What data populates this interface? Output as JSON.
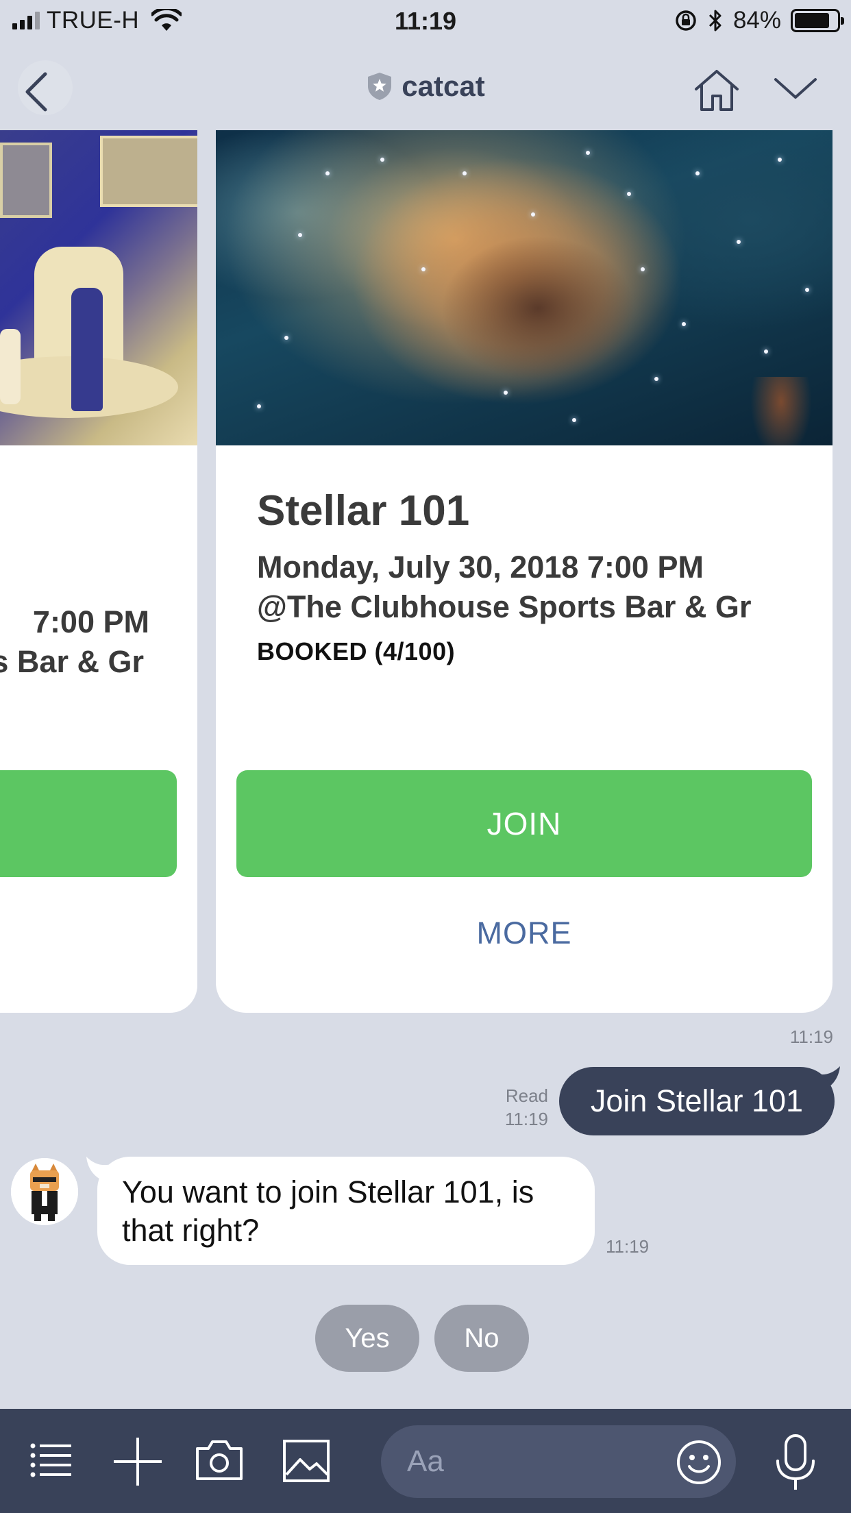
{
  "status_bar": {
    "carrier": "TRUE-H",
    "time": "11:19",
    "battery_percent": "84%",
    "battery_level": 0.84,
    "signal_bars": 3
  },
  "header": {
    "title": "catcat",
    "icons": [
      "back-arrow-icon",
      "shield-star-icon",
      "home-icon",
      "chevron-down-icon"
    ]
  },
  "carousel": {
    "left_card": {
      "date_fragment": "7:00 PM",
      "venue_fragment": "s Bar & Gr"
    },
    "main_card": {
      "title": "Stellar 101",
      "date": "Monday, July 30, 2018 7:00 PM",
      "venue": "@The Clubhouse Sports Bar & Gr",
      "booked": "BOOKED (4/100)",
      "join_label": "JOIN",
      "more_label": "MORE"
    },
    "timestamp": "11:19"
  },
  "messages": {
    "outgoing": {
      "text": "Join Stellar 101",
      "read_label": "Read",
      "read_time": "11:19"
    },
    "incoming": {
      "text": "You want to join Stellar 101, is that right?",
      "time": "11:19"
    }
  },
  "quick_replies": {
    "yes": "Yes",
    "no": "No"
  },
  "input_bar": {
    "placeholder": "Aa",
    "icons": [
      "menu-icon",
      "plus-icon",
      "camera-icon",
      "image-icon",
      "emoji-icon",
      "microphone-icon"
    ]
  },
  "colors": {
    "background": "#d8dce6",
    "navy": "#394259",
    "green": "#5cc662",
    "link": "#4a6aa0",
    "quick_reply": "#9a9ea9"
  }
}
